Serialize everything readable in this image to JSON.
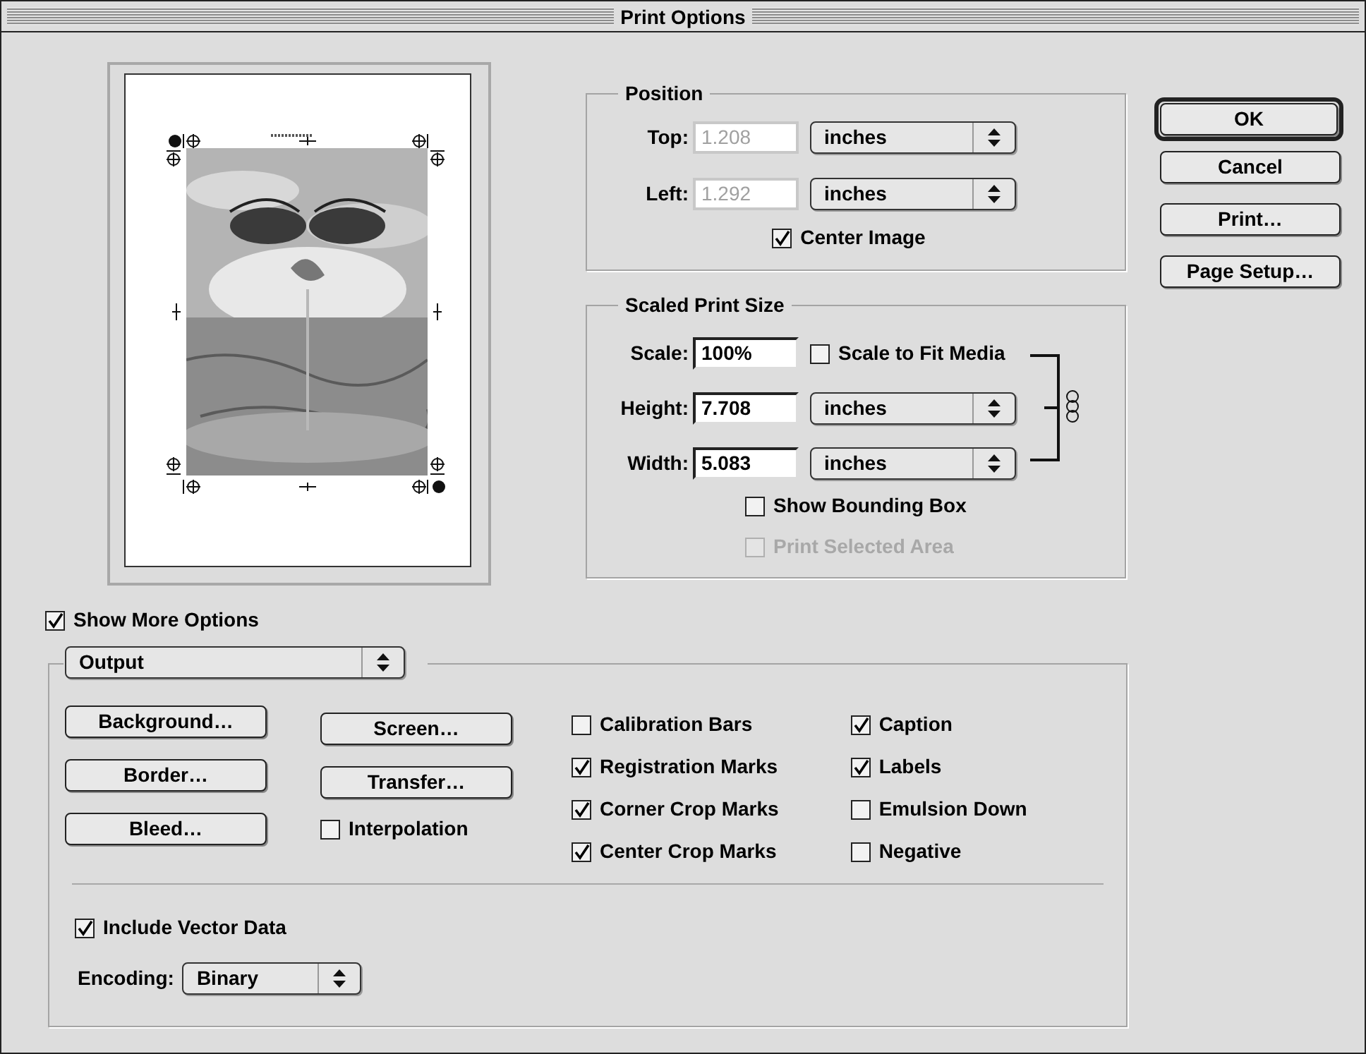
{
  "window": {
    "title": "Print Options"
  },
  "position": {
    "title": "Position",
    "fields": [
      {
        "label": "Top:",
        "value": "1.208",
        "unit": "inches",
        "disabled": true
      },
      {
        "label": "Left:",
        "value": "1.292",
        "unit": "inches",
        "disabled": true
      }
    ],
    "center_image": {
      "label": "Center Image",
      "checked": true
    }
  },
  "scaled_print_size": {
    "title": "Scaled Print Size",
    "scale": {
      "label": "Scale:",
      "value": "100%"
    },
    "scale_to_fit": {
      "label": "Scale to Fit Media",
      "checked": false
    },
    "fields": [
      {
        "label": "Height:",
        "value": "7.708",
        "unit": "inches"
      },
      {
        "label": "Width:",
        "value": "5.083",
        "unit": "inches"
      }
    ],
    "options": [
      {
        "label": "Show Bounding Box",
        "checked": false,
        "disabled": false
      },
      {
        "label": "Print Selected Area",
        "checked": false,
        "disabled": true
      }
    ]
  },
  "buttons": [
    {
      "label": "OK",
      "default": true
    },
    {
      "label": "Cancel",
      "default": false
    },
    {
      "label": "Print…",
      "default": false
    },
    {
      "label": "Page Setup…",
      "default": false
    }
  ],
  "show_more_options": {
    "label": "Show More Options",
    "checked": true
  },
  "output": {
    "menu": "Output",
    "buttons_column_1": [
      "Background…",
      "Border…",
      "Bleed…"
    ],
    "buttons_column_2": [
      "Screen…",
      "Transfer…"
    ],
    "interpolation": {
      "label": "Interpolation",
      "checked": false
    },
    "checks_column_3": [
      {
        "label": "Calibration Bars",
        "checked": false
      },
      {
        "label": "Registration Marks",
        "checked": true
      },
      {
        "label": "Corner Crop Marks",
        "checked": true
      },
      {
        "label": "Center Crop Marks",
        "checked": true
      }
    ],
    "checks_column_4": [
      {
        "label": "Caption",
        "checked": true
      },
      {
        "label": "Labels",
        "checked": true
      },
      {
        "label": "Emulsion Down",
        "checked": false
      },
      {
        "label": "Negative",
        "checked": false
      }
    ],
    "include_vector_data": {
      "label": "Include Vector Data",
      "checked": true
    },
    "encoding": {
      "label": "Encoding:",
      "value": "Binary"
    }
  }
}
